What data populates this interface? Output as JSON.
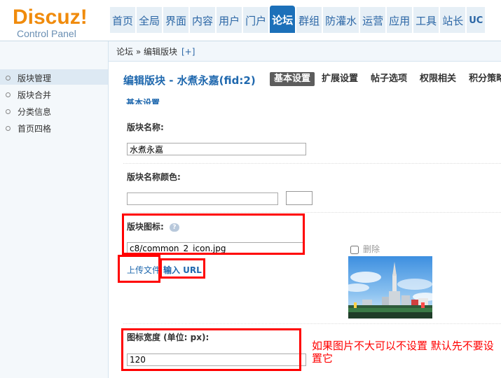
{
  "app": {
    "logo_main": "Discuz",
    "logo_excl": "!",
    "logo_sub": "Control Panel"
  },
  "nav": {
    "items": [
      "首页",
      "全局",
      "界面",
      "内容",
      "用户",
      "门户",
      "论坛",
      "群组",
      "防灌水",
      "运营",
      "应用",
      "工具",
      "站长",
      "UC"
    ],
    "active_index": 6
  },
  "breadcrumb": {
    "text": "论坛 » 编辑版块",
    "plus": "[+]"
  },
  "sidebar": {
    "items": [
      "版块管理",
      "版块合并",
      "分类信息",
      "首页四格"
    ],
    "active_index": 0
  },
  "page": {
    "title": "编辑版块 - 水煮永嘉(fid:2)",
    "tabs": [
      "基本设置",
      "扩展设置",
      "帖子选项",
      "权限相关",
      "积分策略"
    ],
    "active_tab": 0,
    "section_head": "基本设置"
  },
  "form": {
    "name_label": "版块名称:",
    "name_value": "水煮永嘉",
    "color_label": "版块名称颜色:",
    "color_value": "",
    "icon_label": "版块图标:",
    "icon_help": "?",
    "icon_value": "c8/common_2_icon.jpg",
    "upload_link": "上传文件",
    "url_link": "输入 URL",
    "delete_label": "删除",
    "width_label": "图标宽度 (单位: px):",
    "width_value": "120"
  },
  "annotation": {
    "note": "如果图片不大可以不设置 默认先不要设置它"
  },
  "colors": {
    "accent": "#1c70b9",
    "logo": "#f08b0c",
    "highlight": "#ff0000"
  }
}
